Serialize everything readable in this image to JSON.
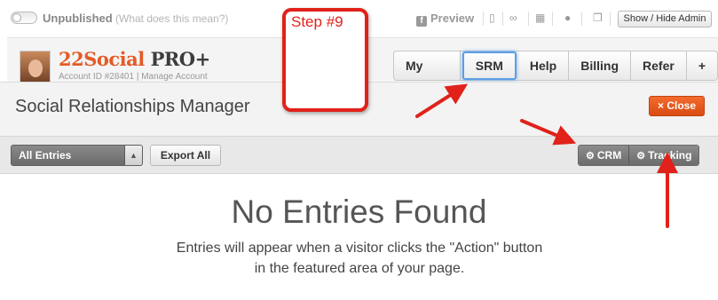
{
  "topbar": {
    "status_label": "Unpublished",
    "status_help": "(What does this mean?)",
    "preview_label": "Preview",
    "show_hide_label": "Show / Hide Admin"
  },
  "header": {
    "brand_primary": "22Social",
    "brand_secondary": "PRO+",
    "account_line": "Account ID #28401 | Manage Account",
    "nav": [
      {
        "label": "My Apps"
      },
      {
        "label": "SRM"
      },
      {
        "label": "Help"
      },
      {
        "label": "Billing"
      },
      {
        "label": "Refer"
      },
      {
        "label": "+"
      }
    ]
  },
  "panel": {
    "title": "Social Relationships Manager",
    "close_label": "× Close",
    "filter_value": "All Entries",
    "export_label": "Export All",
    "crm_label": "CRM",
    "tracking_label": "Tracking"
  },
  "empty": {
    "title": "No Entries Found",
    "line1": "Entries will appear when a visitor clicks the \"Action\" button",
    "line2": "in the featured area of your page."
  },
  "annotation": {
    "step_label": "Step #9"
  },
  "colors": {
    "accent": "#e45b26",
    "annotation": "#e0221a",
    "focus": "#5b9fe6"
  }
}
